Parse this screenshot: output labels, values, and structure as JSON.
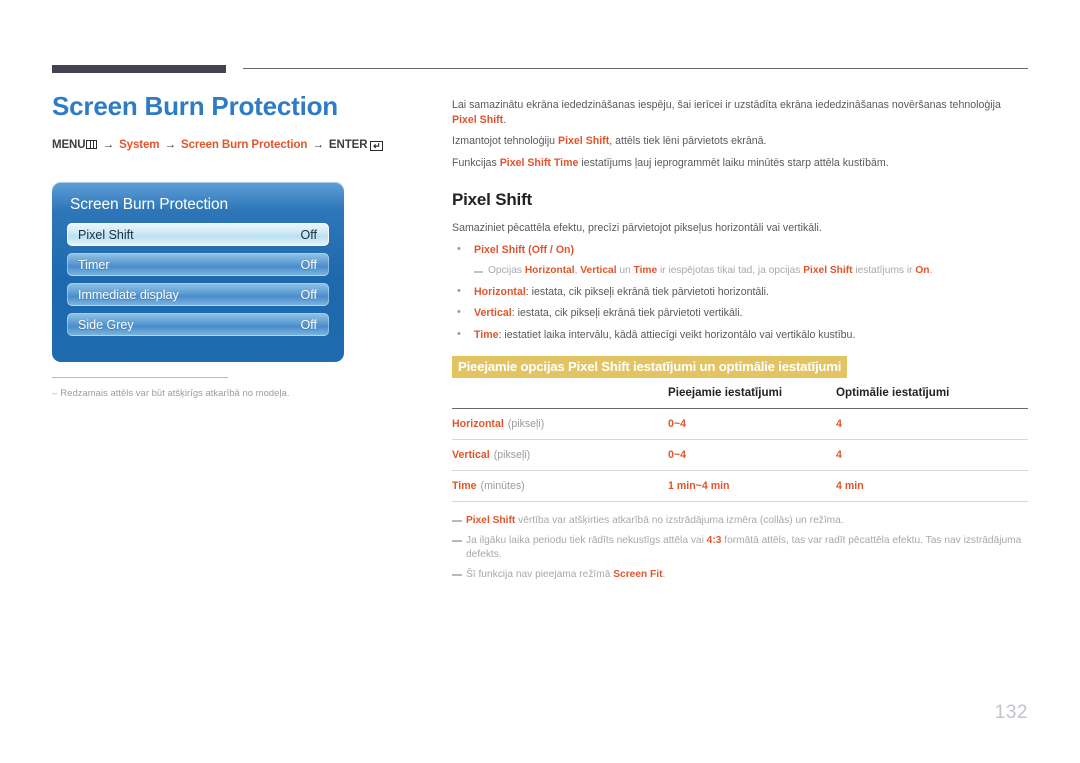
{
  "page": {
    "title": "Screen Burn Protection",
    "number": "132"
  },
  "menu_path": {
    "menu_label": "MENU",
    "menu_icon": "menu-bars-icon",
    "arrow": "→",
    "item1": "System",
    "item2": "Screen Burn Protection",
    "enter_label": "ENTER",
    "enter_icon": "enter-key-icon",
    "enter_glyph": "↵"
  },
  "osd": {
    "title": "Screen Burn Protection",
    "rows": [
      {
        "label": "Pixel Shift",
        "value": "Off",
        "selected": true
      },
      {
        "label": "Timer",
        "value": "Off",
        "selected": false
      },
      {
        "label": "Immediate display",
        "value": "Off",
        "selected": false
      },
      {
        "label": "Side Grey",
        "value": "Off",
        "selected": false
      }
    ]
  },
  "left_note": {
    "dash": "–",
    "text": "Redzamais attēls var būt atšķirīgs atkarībā no modeļa."
  },
  "intro": {
    "p1_a": "Lai samazinātu ekrāna iededzināšanas iespēju, šai ierīcei ir uzstādīta ekrāna iededzināšanas novēršanas tehnoloģija ",
    "p1_hl": "Pixel Shift",
    "p1_b": ".",
    "p2_a": "Izmantojot tehnoloģiju ",
    "p2_hl": "Pixel Shift",
    "p2_b": ", attēls tiek lēni pārvietots ekrānā.",
    "p3_a": "Funkcijas ",
    "p3_hl": "Pixel Shift Time",
    "p3_b": " iestatījums ļauj ieprogrammēt laiku minūtēs starp attēla kustībām."
  },
  "section": {
    "heading": "Pixel Shift",
    "lead": "Samaziniet pēcattēla efektu, precīzi pārvietojot pikseļus horizontāli vai vertikāli.",
    "bullets": [
      {
        "term": "Pixel Shift",
        "rest": " (Off / On)",
        "rest_orange": true
      },
      {
        "term": "Horizontal",
        "rest": ": iestata, cik pikseļi ekrānā tiek pārvietoti horizontāli.",
        "rest_orange": false
      },
      {
        "term": "Vertical",
        "rest": ": iestata, cik pikseļi ekrānā tiek pārvietoti vertikāli.",
        "rest_orange": false
      },
      {
        "term": "Time",
        "rest": ": iestatiet laika intervālu, kādā attiecīgi veikt horizontālo vai vertikālo kustību.",
        "rest_orange": false
      }
    ],
    "subnote": {
      "a": "Opcijas ",
      "t1": "Horizontal",
      "b": ", ",
      "t2": "Vertical",
      "c": " un ",
      "t3": "Time",
      "d": " ir iespējotas tikai tad, ja opcijas ",
      "t4": "Pixel Shift",
      "e": " iestatījums ir ",
      "t5": "On",
      "f": "."
    }
  },
  "table": {
    "title": "Pieejamie opcijas Pixel Shift iestatījumi un optimālie iestatījumi",
    "headers": [
      "",
      "Pieejamie iestatījumi",
      "Optimālie iestatījumi"
    ],
    "rows": [
      {
        "label": "Horizontal",
        "unit": "(pikseļi)",
        "available": "0~4",
        "optimal": "4"
      },
      {
        "label": "Vertical",
        "unit": "(pikseļi)",
        "available": "0~4",
        "optimal": "4"
      },
      {
        "label": "Time",
        "unit": "(minūtes)",
        "available": "1 min~4 min",
        "optimal": "4 min"
      }
    ]
  },
  "bottom_notes": [
    {
      "hl_first": "Pixel Shift",
      "a": " vērtība var atšķirties atkarībā no izstrādājuma izmēra (collās) un režīma.",
      "hl_mid": "",
      "b": ""
    },
    {
      "hl_first": "",
      "a": "Ja ilgāku laika periodu tiek rādīts nekustīgs attēla vai ",
      "hl_mid": "4:3",
      "b": " formātā attēls, tas var radīt pēcattēla efektu. Tas nav izstrādājuma defekts."
    },
    {
      "hl_first": "",
      "a": "Šī funkcija nav pieejama režīmā ",
      "hl_mid": "Screen Fit",
      "b": "."
    }
  ],
  "colors": {
    "accent_blue": "#2e7cc4",
    "accent_orange": "#e2552c",
    "highlight_gold": "#e2c463",
    "rule_dark": "#474251",
    "page_number": "#c3c3cb"
  }
}
